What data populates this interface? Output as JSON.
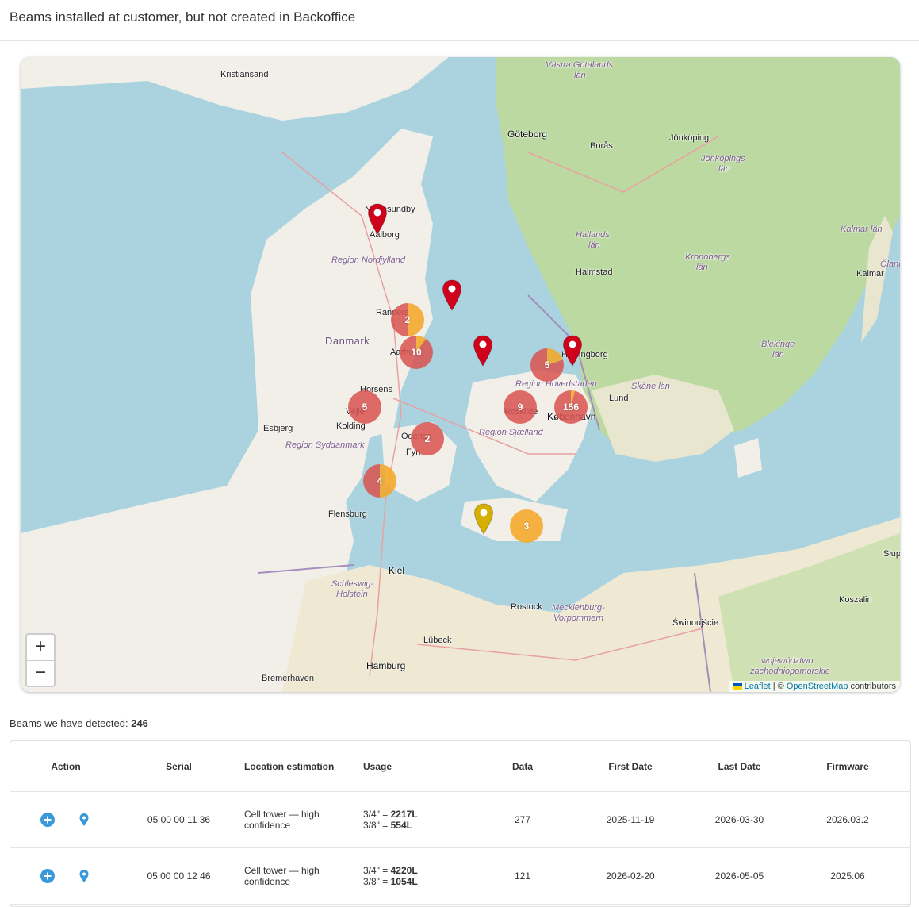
{
  "header": {
    "title": "Beams installed at customer, but not created in Backoffice"
  },
  "map": {
    "labels": [
      {
        "text": "Kristiansand",
        "cls": ""
      },
      {
        "text": "Västra Götalands",
        "cls": "region"
      },
      {
        "text": "län",
        "cls": "region"
      },
      {
        "text": "Göteborg",
        "cls": "city-big"
      },
      {
        "text": "Borås",
        "cls": ""
      },
      {
        "text": "Jönköping",
        "cls": ""
      },
      {
        "text": "Jönköpings",
        "cls": "region"
      },
      {
        "text": "län",
        "cls": "region"
      },
      {
        "text": "Nørresundby",
        "cls": ""
      },
      {
        "text": "Aalborg",
        "cls": ""
      },
      {
        "text": "Region Nordjylland",
        "cls": "region"
      },
      {
        "text": "Hallands",
        "cls": "region"
      },
      {
        "text": "län",
        "cls": "region"
      },
      {
        "text": "Kronobergs",
        "cls": "region"
      },
      {
        "text": "län",
        "cls": "region"
      },
      {
        "text": "Kalmar län",
        "cls": "region"
      },
      {
        "text": "Öland",
        "cls": "region"
      },
      {
        "text": "Halmstad",
        "cls": ""
      },
      {
        "text": "Kalmar",
        "cls": ""
      },
      {
        "text": "Randers",
        "cls": ""
      },
      {
        "text": "Danmark",
        "cls": "country"
      },
      {
        "text": "Aarhus",
        "cls": ""
      },
      {
        "text": "Helsingborg",
        "cls": ""
      },
      {
        "text": "Blekinge",
        "cls": "region"
      },
      {
        "text": "län",
        "cls": "region"
      },
      {
        "text": "Region Hovedstaden",
        "cls": "region"
      },
      {
        "text": "Skåne län",
        "cls": "region"
      },
      {
        "text": "Horsens",
        "cls": ""
      },
      {
        "text": "Lund",
        "cls": ""
      },
      {
        "text": "Vejle",
        "cls": ""
      },
      {
        "text": "Roskilde",
        "cls": ""
      },
      {
        "text": "København",
        "cls": "city-big"
      },
      {
        "text": "Kolding",
        "cls": ""
      },
      {
        "text": "Esbjerg",
        "cls": ""
      },
      {
        "text": "Odense",
        "cls": ""
      },
      {
        "text": "Region Sjælland",
        "cls": "region"
      },
      {
        "text": "Region Syddanmark",
        "cls": "region"
      },
      {
        "text": "Fyn",
        "cls": ""
      },
      {
        "text": "Flensburg",
        "cls": ""
      },
      {
        "text": "Kiel",
        "cls": "city-big"
      },
      {
        "text": "Schleswig-",
        "cls": "region"
      },
      {
        "text": "Holstein",
        "cls": "region"
      },
      {
        "text": "Rostock",
        "cls": ""
      },
      {
        "text": "Mecklenburg-",
        "cls": "region"
      },
      {
        "text": "Vorpommern",
        "cls": "region"
      },
      {
        "text": "Świnoujście",
        "cls": ""
      },
      {
        "text": "Koszalin",
        "cls": ""
      },
      {
        "text": "Słup",
        "cls": ""
      },
      {
        "text": "Lübeck",
        "cls": ""
      },
      {
        "text": "Hamburg",
        "cls": "city-big"
      },
      {
        "text": "Bremerhaven",
        "cls": ""
      },
      {
        "text": "województwo",
        "cls": "region"
      },
      {
        "text": "zachodniopomorskie",
        "cls": "region"
      }
    ],
    "clusters": [
      {
        "count": "2",
        "orange_share": 0.5
      },
      {
        "count": "10",
        "orange_share": 0.1
      },
      {
        "count": "5",
        "orange_share": 0.2
      },
      {
        "count": "5",
        "orange_share": 0
      },
      {
        "count": "9",
        "orange_share": 0
      },
      {
        "count": "156",
        "orange_share": 0.04
      },
      {
        "count": "2",
        "orange_share": 0
      },
      {
        "count": "4",
        "orange_share": 0.5
      },
      {
        "count": "3",
        "orange_share": 1
      }
    ],
    "pins": [
      {
        "color": "#d0021b"
      },
      {
        "color": "#d0021b"
      },
      {
        "color": "#d0021b"
      },
      {
        "color": "#d0021b"
      },
      {
        "color": "#d6b000"
      }
    ],
    "colors": {
      "red": "#d9534f",
      "orange": "#f5a623",
      "water": "#aad3df",
      "land": "#f2efe9",
      "forest": "#bcd9a2"
    },
    "zoom_in": "+",
    "zoom_out": "−",
    "attribution": {
      "leaflet": "Leaflet",
      "sep": " | © ",
      "osm": "OpenStreetMap",
      "rest": " contributors"
    }
  },
  "summary": {
    "label": "Beams we have detected: ",
    "count": "246"
  },
  "table": {
    "headers": {
      "action": "Action",
      "serial": "Serial",
      "location": "Location estimation",
      "usage": "Usage",
      "data": "Data",
      "first": "First Date",
      "last": "Last Date",
      "firmware": "Firmware"
    },
    "rows": [
      {
        "serial": "05 00 00 11 36",
        "location": "Cell tower — high confidence",
        "usage1_label": "3/4\" = ",
        "usage1_value": "2217L",
        "usage2_label": "3/8\" = ",
        "usage2_value": "554L",
        "data": "277",
        "first": "2025-11-19",
        "last": "2026-03-30",
        "firmware": "2026.03.2"
      },
      {
        "serial": "05 00 00 12 46",
        "location": "Cell tower — high confidence",
        "usage1_label": "3/4\" = ",
        "usage1_value": "4220L",
        "usage2_label": "3/8\" = ",
        "usage2_value": "1054L",
        "data": "121",
        "first": "2026-02-20",
        "last": "2026-05-05",
        "firmware": "2025.06"
      }
    ]
  }
}
